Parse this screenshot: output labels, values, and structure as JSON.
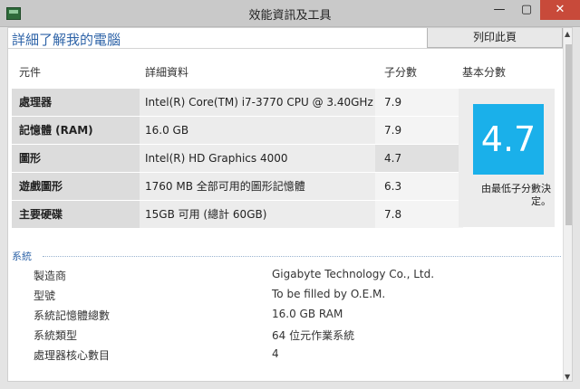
{
  "window": {
    "title": "效能資訊及工具",
    "controls": {
      "minimize": "—",
      "maximize": "▢",
      "close": "✕"
    }
  },
  "header": {
    "page_title": "詳細了解我的電腦",
    "print_label": "列印此頁"
  },
  "score_table": {
    "columns": [
      "元件",
      "詳細資料",
      "子分數",
      "基本分數"
    ],
    "rows": [
      {
        "component": "處理器",
        "detail": "Intel(R) Core(TM) i7-3770 CPU @ 3.40GHz",
        "subscore": "7.9"
      },
      {
        "component": "記憶體 (RAM)",
        "detail": "16.0 GB",
        "subscore": "7.9"
      },
      {
        "component": "圖形",
        "detail": "Intel(R) HD Graphics 4000",
        "subscore": "4.7"
      },
      {
        "component": "遊戲圖形",
        "detail": "1760 MB 全部可用的圖形記憶體",
        "subscore": "6.3"
      },
      {
        "component": "主要硬碟",
        "detail": "15GB 可用 (總計 60GB)",
        "subscore": "7.8"
      }
    ],
    "base_score": "4.7",
    "base_note": "由最低子分數決定。"
  },
  "system": {
    "title": "系統",
    "rows": [
      {
        "label": "製造商",
        "value": "Gigabyte Technology Co., Ltd."
      },
      {
        "label": "型號",
        "value": "To be filled by O.E.M."
      },
      {
        "label": "系統記憶體總數",
        "value": "16.0 GB RAM"
      },
      {
        "label": "系統類型",
        "value": "64 位元作業系統"
      },
      {
        "label": "處理器核心數目",
        "value": "4"
      }
    ]
  },
  "scrollbar": {
    "up_icon": "▲",
    "down_icon": "▼"
  },
  "colors": {
    "accent": "#2f64a8",
    "score_tile": "#1ab0ea",
    "close_button": "#c84a3a"
  }
}
